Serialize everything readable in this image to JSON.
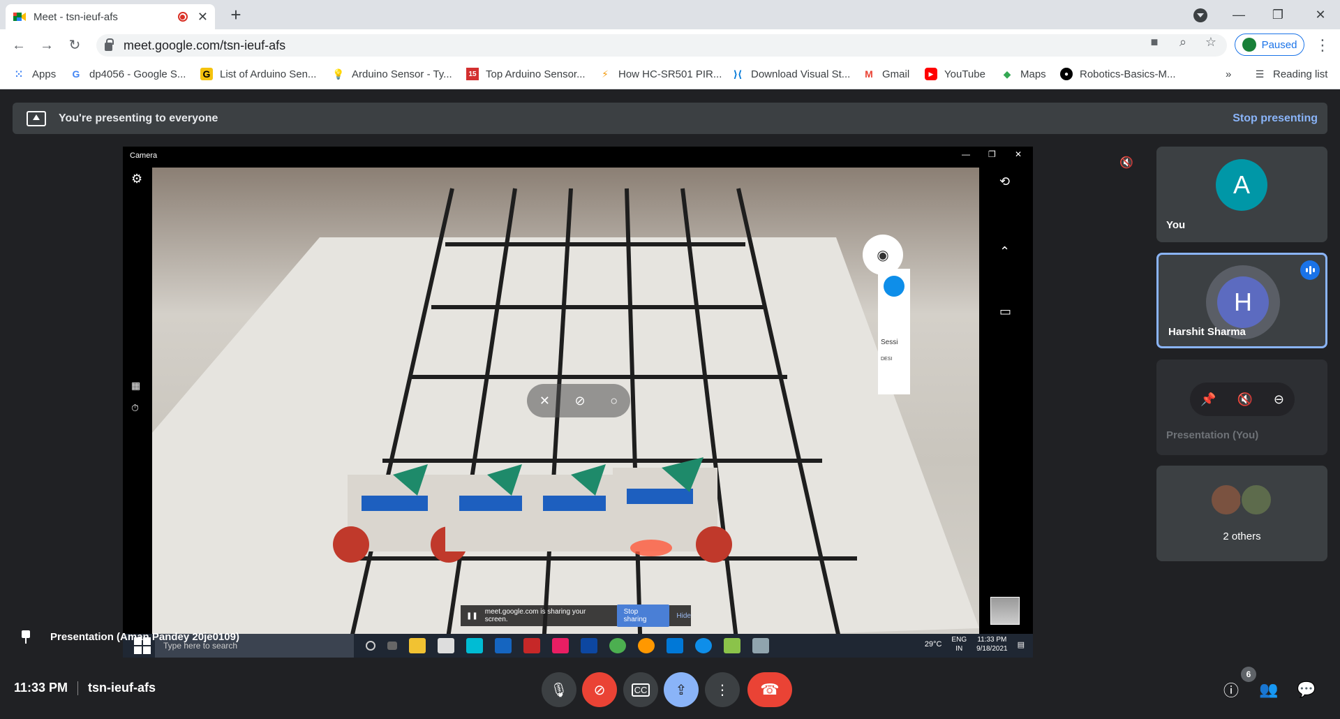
{
  "browser": {
    "tab_title": "Meet - tsn-ieuf-afs",
    "url": "meet.google.com/tsn-ieuf-afs",
    "profile_status": "Paused",
    "reading_list": "Reading list",
    "overflow": "»"
  },
  "bookmarks": [
    {
      "label": "Apps",
      "icon": "apps-grid-icon"
    },
    {
      "label": "dp4056 - Google S...",
      "icon": "google-icon"
    },
    {
      "label": "List of Arduino Sen...",
      "icon": "g-icon"
    },
    {
      "label": "Arduino Sensor - Ty...",
      "icon": "bulb-icon"
    },
    {
      "label": "Top Arduino Sensor...",
      "icon": "site-icon"
    },
    {
      "label": "How HC-SR501 PIR...",
      "icon": "site-icon"
    },
    {
      "label": "Download Visual St...",
      "icon": "vscode-icon"
    },
    {
      "label": "Gmail",
      "icon": "gmail-icon"
    },
    {
      "label": "YouTube",
      "icon": "youtube-icon"
    },
    {
      "label": "Maps",
      "icon": "maps-icon"
    },
    {
      "label": "Robotics-Basics-M...",
      "icon": "github-icon"
    }
  ],
  "banner": {
    "message": "You're presenting to everyone",
    "stop": "Stop presenting"
  },
  "shared_screen": {
    "window_title": "Camera",
    "share_note": "meet.google.com is sharing your screen.",
    "stop_sharing": "Stop sharing",
    "hide": "Hide",
    "taskbar_search": "Type here to search",
    "temperature": "29°C",
    "lang": "ENG",
    "region": "IN",
    "time": "11:33 PM",
    "date": "9/18/2021",
    "teamviewer_text": "Sessi",
    "teamviewer_sub": "DESI"
  },
  "presentation_label": "Presentation (Aman Pandey 20je0109)",
  "participants": [
    {
      "initial": "A",
      "name": "You",
      "color": "#0097a7"
    },
    {
      "initial": "H",
      "name": "Harshit Sharma",
      "color": "#5c6bc0"
    },
    {
      "name": "Presentation (You)"
    },
    {
      "name": "2 others"
    }
  ],
  "bottom": {
    "time": "11:33 PM",
    "meeting_code": "tsn-ieuf-afs",
    "participant_count": "6"
  }
}
